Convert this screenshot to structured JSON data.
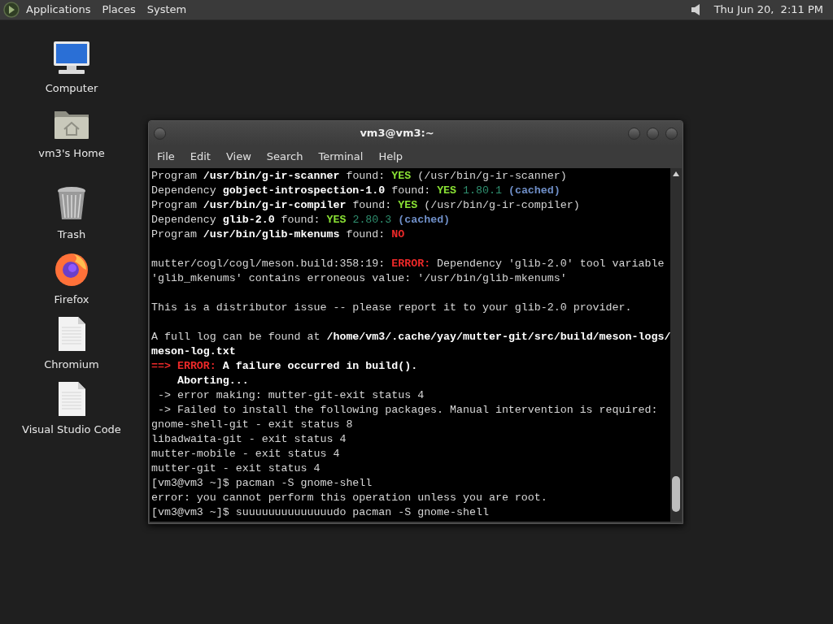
{
  "top_panel": {
    "menus": [
      "Applications",
      "Places",
      "System"
    ],
    "clock": "Thu Jun 20,  2:11 PM"
  },
  "desktop_icons": [
    {
      "kind": "computer",
      "label": "Computer"
    },
    {
      "kind": "home",
      "label": "vm3's Home"
    },
    {
      "kind": "trash",
      "label": "Trash"
    },
    {
      "kind": "firefox",
      "label": "Firefox"
    },
    {
      "kind": "document",
      "label": "Chromium"
    },
    {
      "kind": "document",
      "label": "Visual Studio Code"
    }
  ],
  "terminal": {
    "title": "vm3@vm3:~",
    "menu": [
      "File",
      "Edit",
      "View",
      "Search",
      "Terminal",
      "Help"
    ],
    "lines": [
      {
        "kind": "text",
        "segments": [
          {
            "kind": "plain",
            "text": "Program "
          },
          {
            "kind": "bold",
            "text": "/usr/bin/g-ir-scanner"
          },
          {
            "kind": "plain",
            "text": " found: "
          },
          {
            "kind": "yes",
            "text": "YES"
          },
          {
            "kind": "plain",
            "text": " (/usr/bin/g-ir-scanner)"
          }
        ]
      },
      {
        "kind": "text",
        "segments": [
          {
            "kind": "plain",
            "text": "Dependency "
          },
          {
            "kind": "bold",
            "text": "gobject-introspection-1.0"
          },
          {
            "kind": "plain",
            "text": " found: "
          },
          {
            "kind": "yes",
            "text": "YES"
          },
          {
            "kind": "version",
            "text": " 1.80.1"
          },
          {
            "kind": "cached",
            "text": " (cached)"
          }
        ]
      },
      {
        "kind": "text",
        "segments": [
          {
            "kind": "plain",
            "text": "Program "
          },
          {
            "kind": "bold",
            "text": "/usr/bin/g-ir-compiler"
          },
          {
            "kind": "plain",
            "text": " found: "
          },
          {
            "kind": "yes",
            "text": "YES"
          },
          {
            "kind": "plain",
            "text": " (/usr/bin/g-ir-compiler)"
          }
        ]
      },
      {
        "kind": "text",
        "segments": [
          {
            "kind": "plain",
            "text": "Dependency "
          },
          {
            "kind": "bold",
            "text": "glib-2.0"
          },
          {
            "kind": "plain",
            "text": " found: "
          },
          {
            "kind": "yes",
            "text": "YES"
          },
          {
            "kind": "version",
            "text": " 2.80.3"
          },
          {
            "kind": "cached",
            "text": " (cached)"
          }
        ]
      },
      {
        "kind": "text",
        "segments": [
          {
            "kind": "plain",
            "text": "Program "
          },
          {
            "kind": "bold",
            "text": "/usr/bin/glib-mkenums"
          },
          {
            "kind": "plain",
            "text": " found: "
          },
          {
            "kind": "no",
            "text": "NO"
          }
        ]
      },
      {
        "kind": "blank"
      },
      {
        "kind": "text",
        "segments": [
          {
            "kind": "plain",
            "text": "mutter/cogl/cogl/meson.build:358:19: "
          },
          {
            "kind": "error",
            "text": "ERROR:"
          },
          {
            "kind": "plain",
            "text": " Dependency 'glib-2.0' tool variable"
          }
        ]
      },
      {
        "kind": "text",
        "segments": [
          {
            "kind": "plain",
            "text": "'glib_mkenums' contains erroneous value: '/usr/bin/glib-mkenums'"
          }
        ]
      },
      {
        "kind": "blank"
      },
      {
        "kind": "text",
        "segments": [
          {
            "kind": "plain",
            "text": "This is a distributor issue -- please report it to your glib-2.0 provider."
          }
        ]
      },
      {
        "kind": "blank"
      },
      {
        "kind": "text",
        "segments": [
          {
            "kind": "plain",
            "text": "A full log can be found at "
          },
          {
            "kind": "bold",
            "text": "/home/vm3/.cache/yay/mutter-git/src/build/meson-logs/"
          }
        ]
      },
      {
        "kind": "text",
        "segments": [
          {
            "kind": "bold",
            "text": "meson-log.txt"
          }
        ]
      },
      {
        "kind": "text",
        "segments": [
          {
            "kind": "error",
            "text": "==> ERROR:"
          },
          {
            "kind": "bold",
            "text": " A failure occurred in build()."
          }
        ]
      },
      {
        "kind": "text",
        "segments": [
          {
            "kind": "bold",
            "text": "    Aborting..."
          }
        ]
      },
      {
        "kind": "text",
        "segments": [
          {
            "kind": "plain",
            "text": " -> error making: mutter-git-exit status 4"
          }
        ]
      },
      {
        "kind": "text",
        "segments": [
          {
            "kind": "plain",
            "text": " -> Failed to install the following packages. Manual intervention is required:"
          }
        ]
      },
      {
        "kind": "text",
        "segments": [
          {
            "kind": "plain",
            "text": "gnome-shell-git - exit status 8"
          }
        ]
      },
      {
        "kind": "text",
        "segments": [
          {
            "kind": "plain",
            "text": "libadwaita-git - exit status 4"
          }
        ]
      },
      {
        "kind": "text",
        "segments": [
          {
            "kind": "plain",
            "text": "mutter-mobile - exit status 4"
          }
        ]
      },
      {
        "kind": "text",
        "segments": [
          {
            "kind": "plain",
            "text": "mutter-git - exit status 4"
          }
        ]
      },
      {
        "kind": "text",
        "segments": [
          {
            "kind": "plain",
            "text": "[vm3@vm3 ~]$ pacman -S gnome-shell"
          }
        ]
      },
      {
        "kind": "text",
        "segments": [
          {
            "kind": "plain",
            "text": "error: you cannot perform this operation unless you are root."
          }
        ]
      },
      {
        "kind": "text",
        "segments": [
          {
            "kind": "plain",
            "text": "[vm3@vm3 ~]$ suuuuuuuuuuuuuudo pacman -S gnome-shell"
          }
        ]
      }
    ]
  }
}
